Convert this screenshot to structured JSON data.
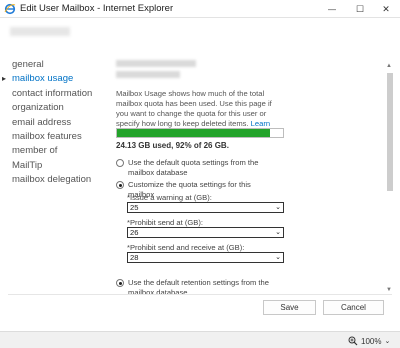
{
  "window": {
    "title": "Edit User Mailbox - Internet Explorer",
    "minimize_symbol": "—",
    "maximize_symbol": "☐",
    "close_symbol": "✕"
  },
  "nav": {
    "items": [
      {
        "label": "general",
        "active": false
      },
      {
        "label": "mailbox usage",
        "active": true
      },
      {
        "label": "contact information",
        "active": false
      },
      {
        "label": "organization",
        "active": false
      },
      {
        "label": "email address",
        "active": false
      },
      {
        "label": "mailbox features",
        "active": false
      },
      {
        "label": "member of",
        "active": false
      },
      {
        "label": "MailTip",
        "active": false
      },
      {
        "label": "mailbox delegation",
        "active": false
      }
    ],
    "active_arrow": "▸"
  },
  "usage": {
    "description": "Mailbox Usage shows how much of the total mailbox quota has been used. Use this page if you want to change the quota for this user or specify how long to keep deleted items.",
    "learn_more": "Learn more",
    "percent_used": 92,
    "summary": "24.13 GB used, 92% of 26 GB."
  },
  "quota": {
    "default_label": "Use the default quota settings from the mailbox database",
    "custom_label": "Customize the quota settings for this mailbox",
    "issue_warning_label": "*Issue a warning at (GB):",
    "issue_warning_value": "25",
    "prohibit_send_label": "*Prohibit send at (GB):",
    "prohibit_send_value": "26",
    "prohibit_send_receive_label": "*Prohibit send and receive at (GB):",
    "prohibit_send_receive_value": "28",
    "chevron": "⌄"
  },
  "retention": {
    "default_label": "Use the default retention settings from the mailbox database"
  },
  "buttons": {
    "save": "Save",
    "cancel": "Cancel"
  },
  "status": {
    "zoom": "100%"
  },
  "colors": {
    "accent": "#0072c6",
    "progress": "#23a32a"
  }
}
